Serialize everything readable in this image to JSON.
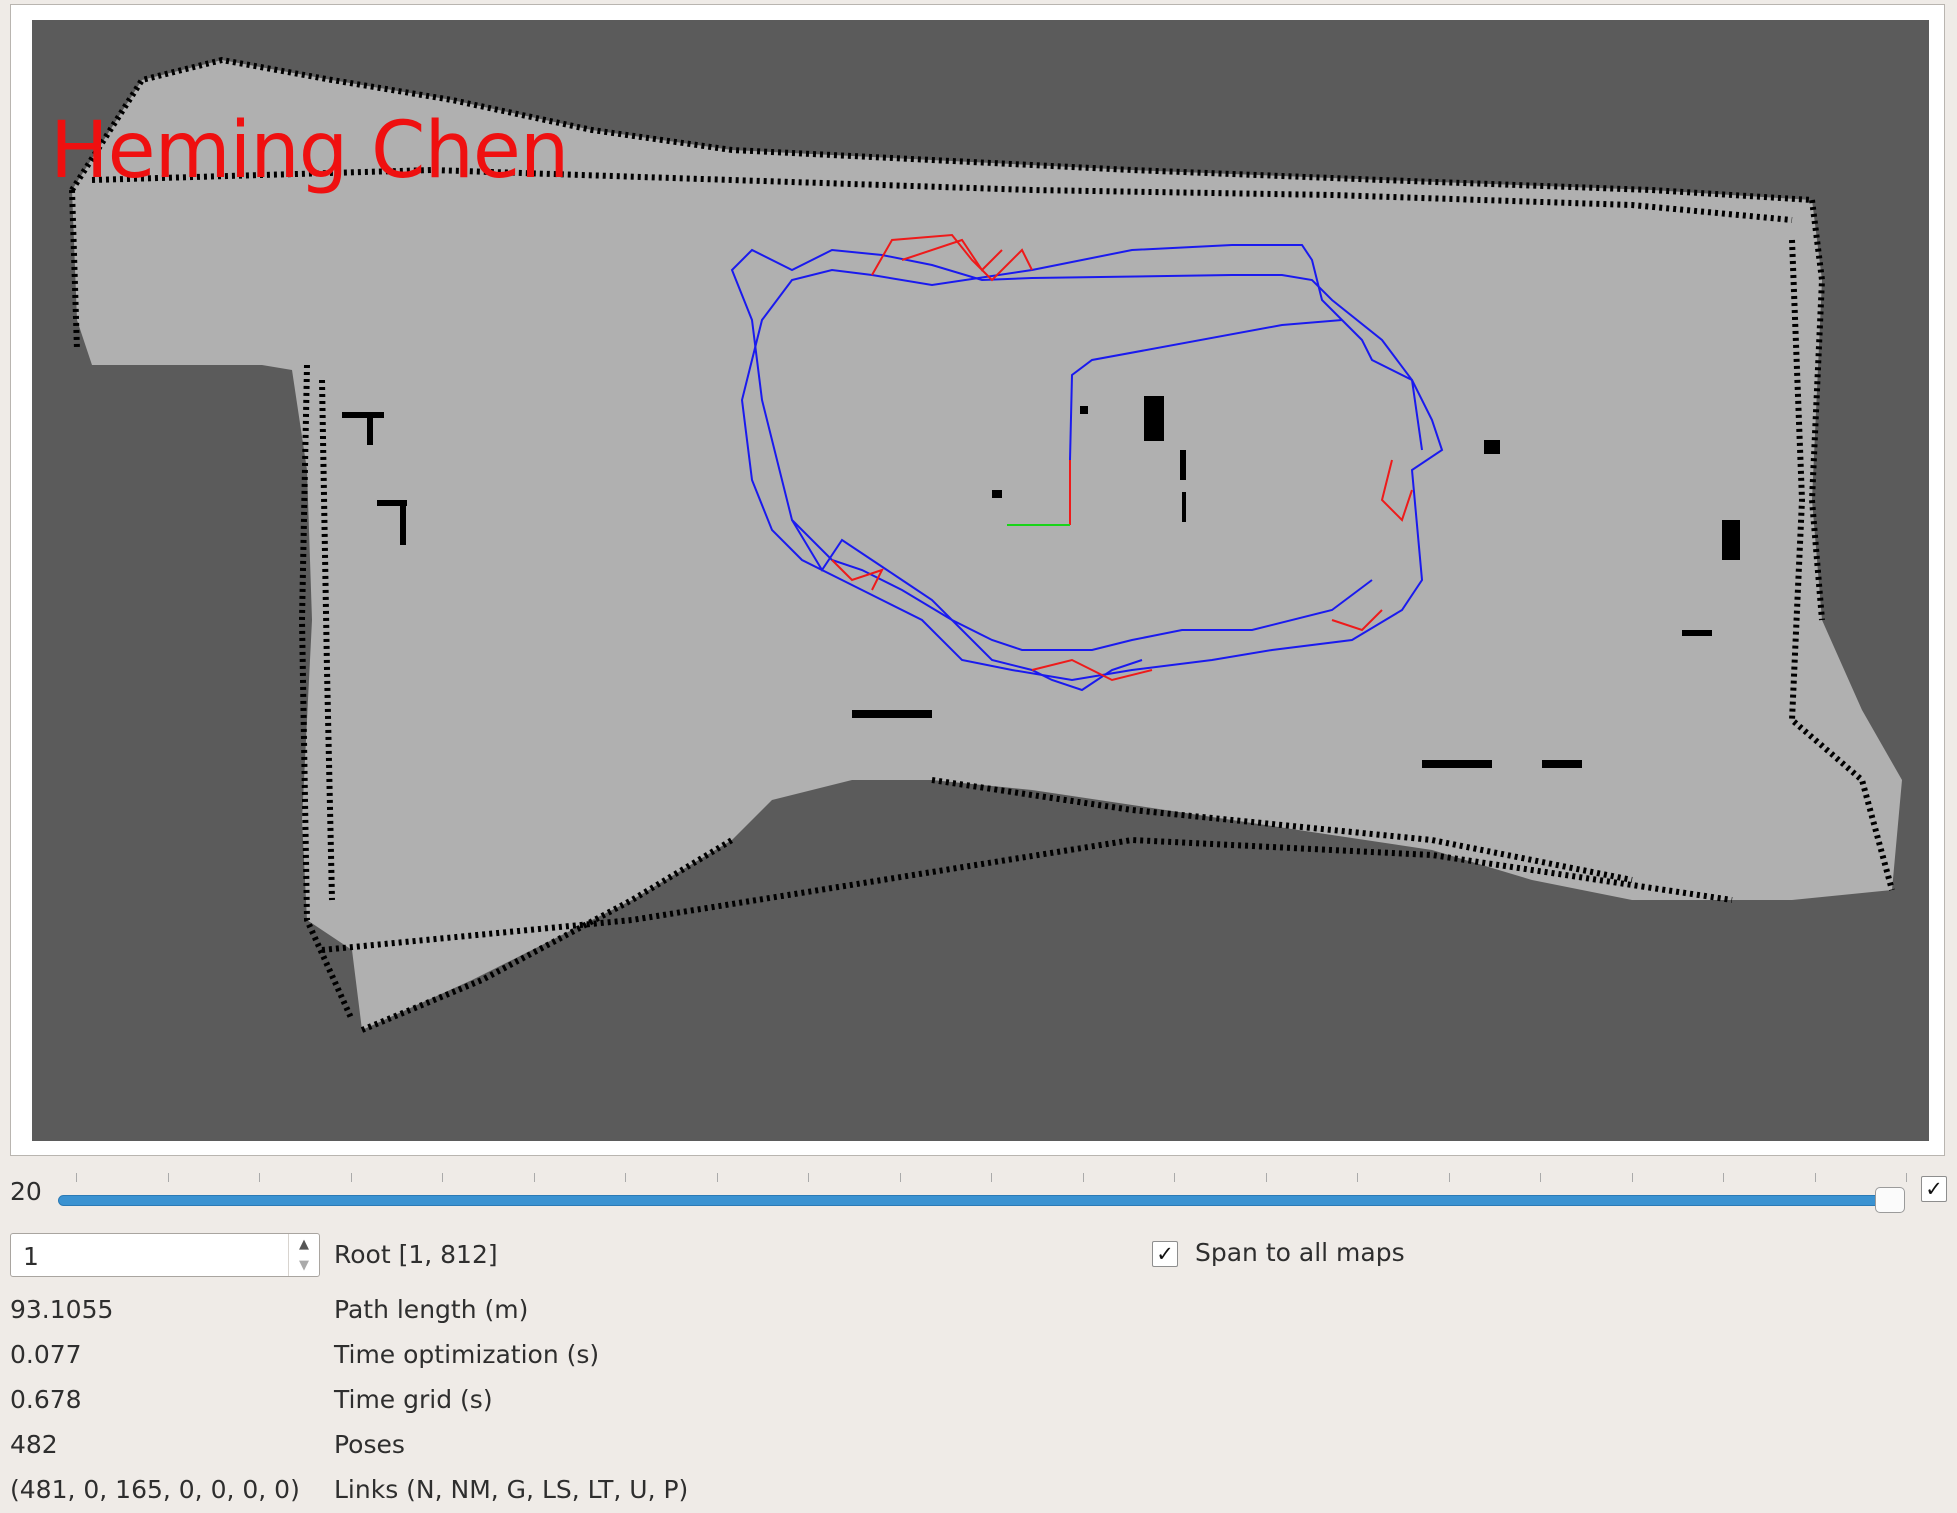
{
  "map": {
    "watermark": "Heming Chen",
    "colors": {
      "background": "#5b5b5b",
      "free_space": "#b0b0b0",
      "obstacle": "#000000",
      "trajectory": "#1a1aee",
      "loop_closure_links": "#ee1a1a",
      "axis_x": "#ee1a1a",
      "axis_y": "#18d418"
    }
  },
  "slider": {
    "value": "20",
    "checked": true
  },
  "root": {
    "spin_value": "1",
    "label": "Root [1, 812]",
    "span_checked": true,
    "span_label": "Span to all maps"
  },
  "stats": [
    {
      "value": "93.1055",
      "label": "Path length (m)"
    },
    {
      "value": "0.077",
      "label": "Time optimization (s)"
    },
    {
      "value": "0.678",
      "label": "Time grid (s)"
    },
    {
      "value": "482",
      "label": "Poses"
    },
    {
      "value": "(481, 0, 165, 0, 0, 0, 0)",
      "label": "Links (N, NM, G, LS, LT, U, P)"
    }
  ],
  "icons": {
    "check": "✓",
    "spin_up": "▲",
    "spin_down": "▼"
  }
}
